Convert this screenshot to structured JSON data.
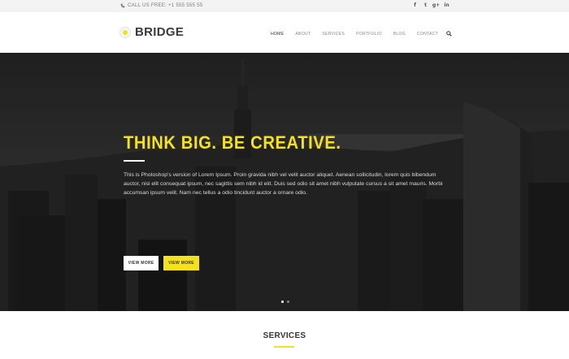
{
  "topbar": {
    "call_label": "CALL US FREE: +1 555 555 55",
    "socials": [
      "f",
      "t",
      "g+",
      "in"
    ]
  },
  "header": {
    "logo_text": "BRIDGE",
    "nav": [
      "HOME",
      "ABOUT",
      "SERVICES",
      "PORTFOLIO",
      "BLOG",
      "CONTACT"
    ]
  },
  "hero": {
    "title": "THINK BIG. BE CREATIVE.",
    "text": "This is Photoshop's version of Lorem Ipsum. Proin gravida nibh vel velit auctor aliquet. Aenean sollicitudin, lorem quis bibendum auctor, nisi elit consequat ipsum, nec sagittis sem nibh id elit. Duis sed odio sit amet nibh vulputate cursus a sit amet mauris. Morbi accumsan ipsum velit. Nam nec tellus a odio tincidunt auctor a ornare odio.",
    "btn_primary": "VIEW MORE",
    "btn_secondary": "VIEW MORE",
    "slides_total": 2,
    "slide_active": 1
  },
  "services": {
    "title": "SERVICES"
  },
  "colors": {
    "accent": "#f5e21a",
    "topbar_bg": "#f3f3f3",
    "hero_bg": "#222222"
  }
}
